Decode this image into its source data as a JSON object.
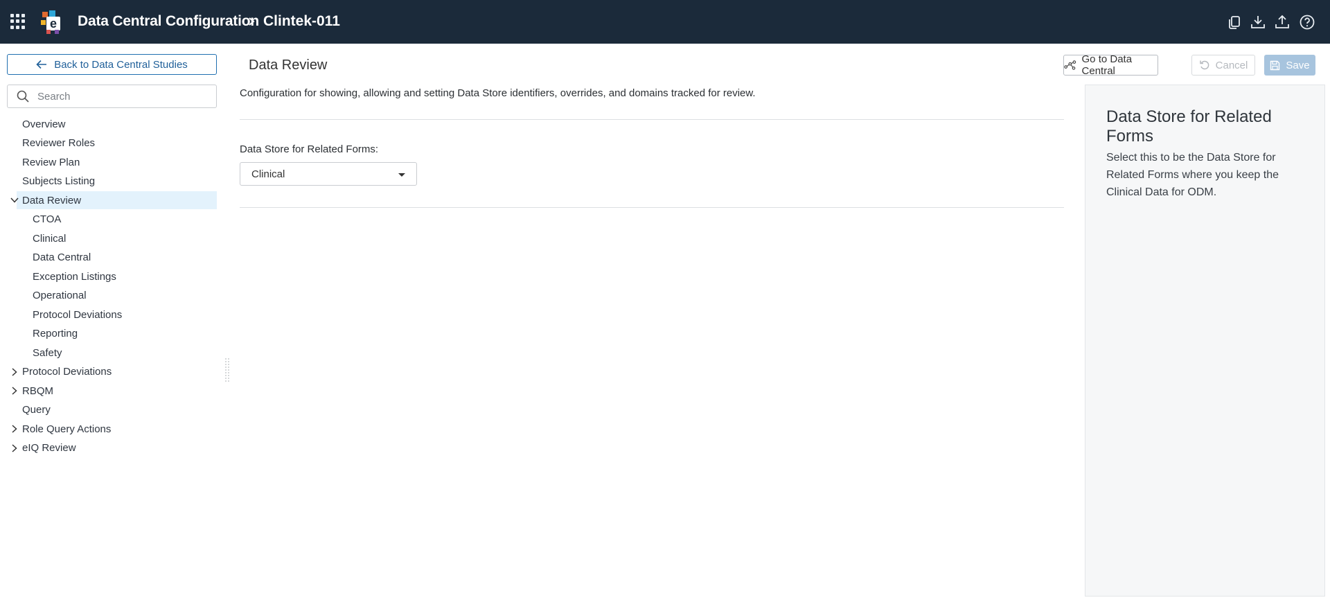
{
  "header": {
    "app_title": "Data Central Configuration",
    "study_name": "Clintek-011",
    "icons": [
      "apps-grid-icon",
      "copy-icon",
      "download-icon",
      "upload-icon",
      "help-icon"
    ]
  },
  "sidebar": {
    "back_label": "Back to Data Central Studies",
    "search_placeholder": "Search",
    "items": [
      {
        "label": "Overview",
        "level": 0,
        "expander": "none"
      },
      {
        "label": "Reviewer Roles",
        "level": 0,
        "expander": "none"
      },
      {
        "label": "Review Plan",
        "level": 0,
        "expander": "none"
      },
      {
        "label": "Subjects Listing",
        "level": 0,
        "expander": "none"
      },
      {
        "label": "Data Review",
        "level": 0,
        "expander": "expanded",
        "selected": true
      },
      {
        "label": "CTOA",
        "level": 1,
        "expander": "none"
      },
      {
        "label": "Clinical",
        "level": 1,
        "expander": "none"
      },
      {
        "label": "Data Central",
        "level": 1,
        "expander": "none"
      },
      {
        "label": "Exception Listings",
        "level": 1,
        "expander": "none"
      },
      {
        "label": "Operational",
        "level": 1,
        "expander": "none"
      },
      {
        "label": "Protocol Deviations",
        "level": 1,
        "expander": "none"
      },
      {
        "label": "Reporting",
        "level": 1,
        "expander": "none"
      },
      {
        "label": "Safety",
        "level": 1,
        "expander": "none"
      },
      {
        "label": "Protocol Deviations",
        "level": 0,
        "expander": "collapsed"
      },
      {
        "label": "RBQM",
        "level": 0,
        "expander": "collapsed"
      },
      {
        "label": "Query",
        "level": 0,
        "expander": "none"
      },
      {
        "label": "Role Query Actions",
        "level": 0,
        "expander": "collapsed"
      },
      {
        "label": "eIQ Review",
        "level": 0,
        "expander": "collapsed"
      }
    ]
  },
  "main": {
    "title": "Data Review",
    "buttons": {
      "goto_label": "Go to Data Central",
      "cancel_label": "Cancel",
      "save_label": "Save"
    },
    "description": "Configuration for showing, allowing and setting Data Store identifiers, overrides, and domains tracked for review.",
    "field_label": "Data Store for Related Forms:",
    "select_value": "Clinical"
  },
  "help_panel": {
    "title": "Data Store for Related Forms",
    "text": "Select this to be the Data Store for Related Forms where you keep the Clinical Data for ODM."
  },
  "colors": {
    "header_bg": "#1b2a3a",
    "accent": "#1f6fb0",
    "selected_bg": "#e3f2fc",
    "save_disabled": "#a7c4de"
  }
}
